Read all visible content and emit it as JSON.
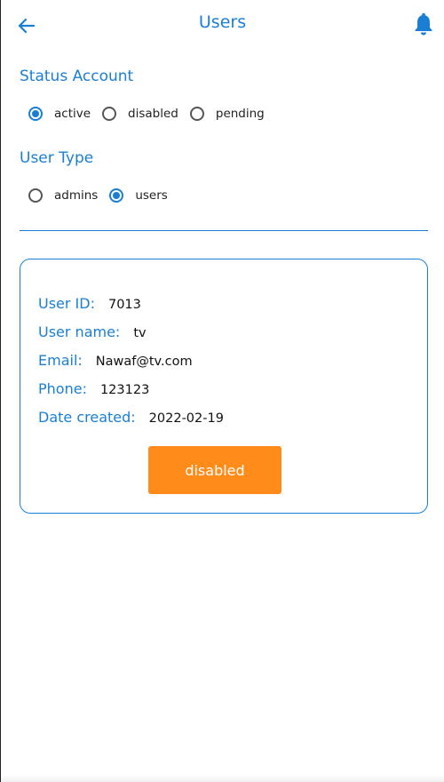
{
  "appbar": {
    "title": "Users",
    "back_icon": "arrow-left-icon",
    "bell_icon": "bell-icon"
  },
  "status_account": {
    "title": "Status Account",
    "options": [
      {
        "label": "active",
        "selected": true
      },
      {
        "label": "disabled",
        "selected": false
      },
      {
        "label": "pending",
        "selected": false
      }
    ]
  },
  "user_type": {
    "title": "User Type",
    "options": [
      {
        "label": "admins",
        "selected": false
      },
      {
        "label": "users",
        "selected": true
      }
    ]
  },
  "user_card": {
    "user_id_label": "User ID:",
    "user_id": "7013",
    "user_name_label": "User name:",
    "user_name": "tv",
    "email_label": "Email:",
    "email": "Nawaf@tv.com",
    "phone_label": "Phone:",
    "phone": "123123",
    "date_created_label": "Date created:",
    "date_created": "2022-02-19",
    "action_button": "disabled"
  },
  "colors": {
    "accent": "#1a7fd4",
    "action": "#ff8c1a"
  }
}
